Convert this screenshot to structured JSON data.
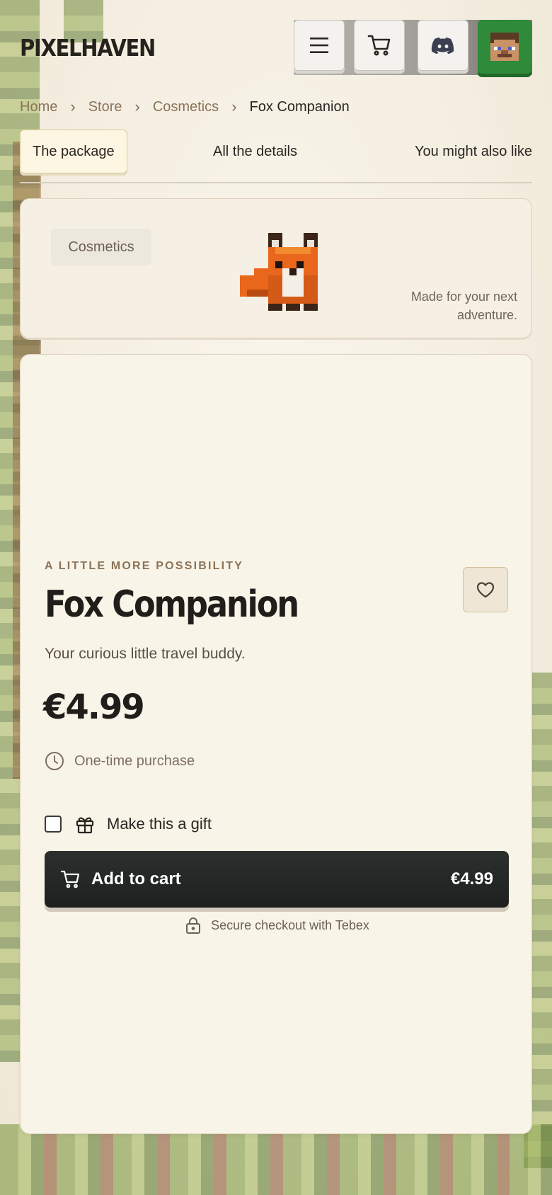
{
  "header": {
    "logo": "PIXELHAVEN",
    "menu_icon": "menu-icon",
    "cart_icon": "cart-icon",
    "discord_icon": "discord-icon",
    "avatar_icon": "avatar-icon"
  },
  "breadcrumb": {
    "items": [
      "Home",
      "Store",
      "Cosmetics",
      "Fox Companion"
    ]
  },
  "tabs": [
    "The package",
    "All the details",
    "You might also like"
  ],
  "hero": {
    "category": "Cosmetics",
    "tagline": "Made for your next adventure."
  },
  "product": {
    "eyebrow": "A LITTLE MORE POSSIBILITY",
    "title": "Fox Companion",
    "subtitle": "Your curious little travel buddy.",
    "price": "€4.99",
    "purchase_type": "One-time purchase",
    "gift_label": "Make this a gift",
    "gift_checked": false,
    "add_to_cart_label": "Add to cart",
    "add_to_cart_price": "€4.99",
    "secure_text": "Secure checkout with Tebex"
  },
  "colors": {
    "accent_dark": "#1d201e",
    "tab_active_bg": "#fdf6e2",
    "avatar_bg": "#2f8a3a",
    "breadcrumb_link": "#8a7459"
  }
}
